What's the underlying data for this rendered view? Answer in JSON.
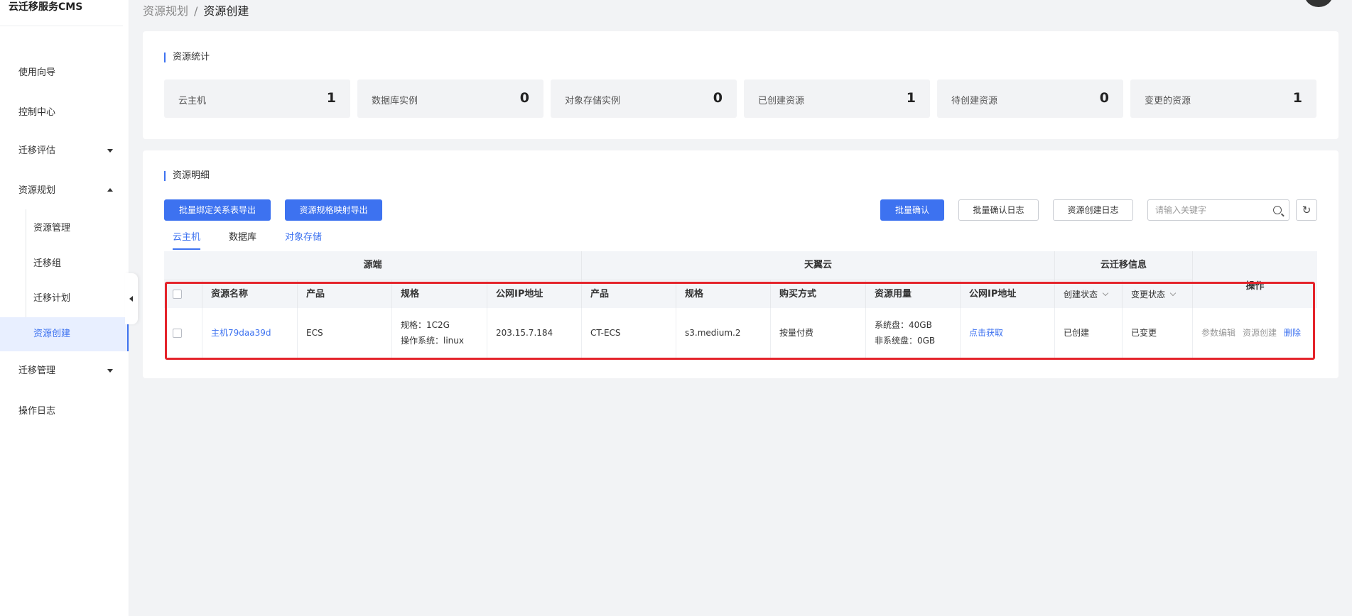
{
  "sidebar": {
    "brand": "云迁移服务CMS",
    "items": [
      {
        "label": "使用向导"
      },
      {
        "label": "控制中心"
      },
      {
        "label": "迁移评估"
      },
      {
        "label": "资源规划"
      },
      {
        "label": "迁移管理"
      },
      {
        "label": "操作日志"
      }
    ],
    "sub_items": [
      {
        "label": "资源管理"
      },
      {
        "label": "迁移组"
      },
      {
        "label": "迁移计划"
      },
      {
        "label": "资源创建"
      }
    ]
  },
  "breadcrumb": {
    "parent": "资源规划",
    "separator": "/",
    "current": "资源创建"
  },
  "stats_card": {
    "title": "资源统计",
    "items": [
      {
        "label": "云主机",
        "value": "1"
      },
      {
        "label": "数据库实例",
        "value": "0"
      },
      {
        "label": "对象存储实例",
        "value": "0"
      },
      {
        "label": "已创建资源",
        "value": "1"
      },
      {
        "label": "待创建资源",
        "value": "0"
      },
      {
        "label": "变更的资源",
        "value": "1"
      }
    ]
  },
  "detail_card": {
    "title": "资源明细",
    "toolbar": {
      "export_binding": "批量绑定关系表导出",
      "export_spec": "资源规格映射导出",
      "batch_confirm": "批量确认",
      "batch_confirm_log": "批量确认日志",
      "create_log": "资源创建日志",
      "search_placeholder": "请输入关键字"
    },
    "tabs": [
      "云主机",
      "数据库",
      "对象存储"
    ],
    "table": {
      "groups": {
        "source": "源端",
        "tianyi": "天翼云",
        "cms": "云迁移信息",
        "ops": "操作"
      },
      "columns": {
        "name": "资源名称",
        "src_product": "产品",
        "src_spec": "规格",
        "src_ip": "公网IP地址",
        "dst_product": "产品",
        "dst_spec": "规格",
        "purchase": "购买方式",
        "usage": "资源用量",
        "dst_ip": "公网IP地址",
        "create_status": "创建状态",
        "change_status": "变更状态"
      },
      "row": {
        "name": "主机79daa39d",
        "src_product": "ECS",
        "src_spec_line1": "规格：1C2G",
        "src_spec_line2": "操作系统：linux",
        "src_ip": "203.15.7.184",
        "dst_product": "CT-ECS",
        "dst_spec": "s3.medium.2",
        "purchase": "按量付费",
        "usage_line1": "系统盘：40GB",
        "usage_line2": "非系统盘：0GB",
        "dst_ip": "点击获取",
        "create_status": "已创建",
        "change_status": "已变更",
        "op_edit": "参数编辑",
        "op_create": "资源创建",
        "op_delete": "删除"
      }
    }
  }
}
